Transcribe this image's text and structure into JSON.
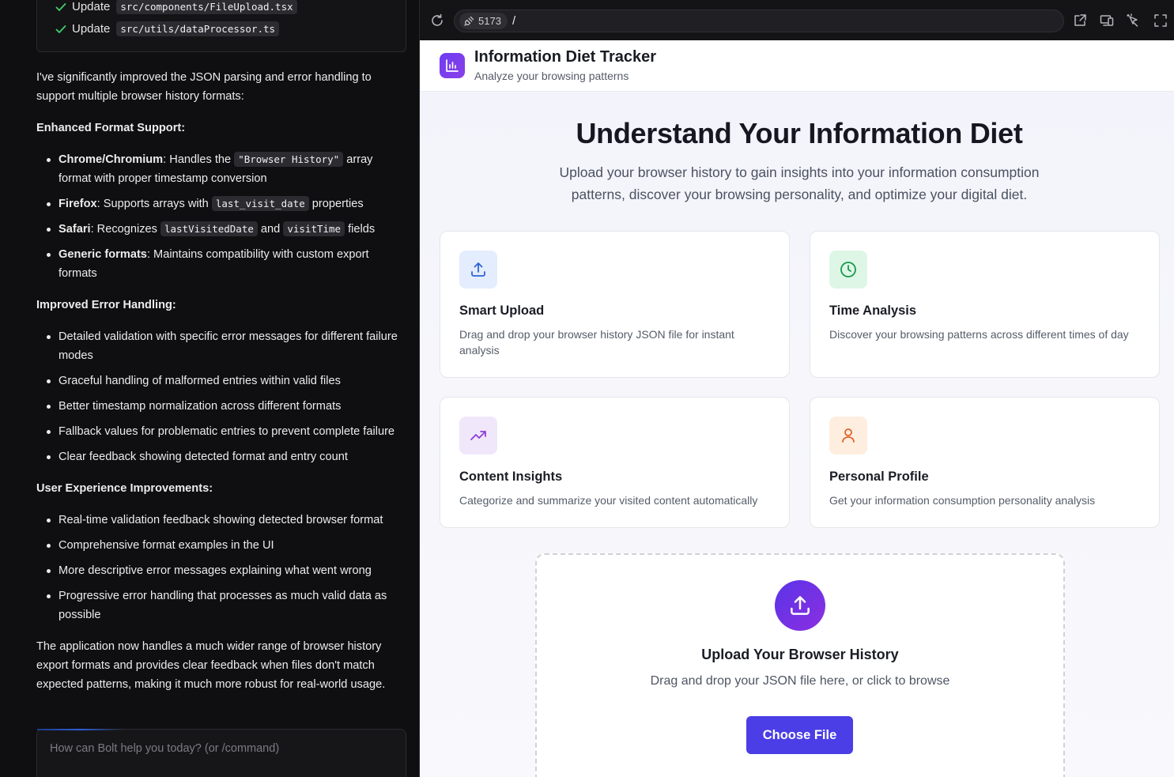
{
  "chat": {
    "files": [
      {
        "action": "Update",
        "path": "src/components/FileUpload.tsx"
      },
      {
        "action": "Update",
        "path": "src/utils/dataProcessor.ts"
      }
    ],
    "intro": "I've significantly improved the JSON parsing and error handling to support multiple browser history formats:",
    "section1_title": "Enhanced Format Support:",
    "s1": {
      "chrome_label": "Chrome/Chromium",
      "chrome_pre": ": Handles the ",
      "chrome_code": "\"Browser History\"",
      "chrome_post": " array format with proper timestamp conversion",
      "firefox_label": "Firefox",
      "firefox_pre": ": Supports arrays with ",
      "firefox_code": "last_visit_date",
      "firefox_post": " properties",
      "safari_label": "Safari",
      "safari_pre": ": Recognizes ",
      "safari_code1": "lastVisitedDate",
      "safari_mid": " and ",
      "safari_code2": "visitTime",
      "safari_post": " fields",
      "generic_label": "Generic formats",
      "generic_text": ": Maintains compatibility with custom export formats"
    },
    "section2_title": "Improved Error Handling:",
    "s2_items": [
      "Detailed validation with specific error messages for different failure modes",
      "Graceful handling of malformed entries within valid files",
      "Better timestamp normalization across different formats",
      "Fallback values for problematic entries to prevent complete failure",
      "Clear feedback showing detected format and entry count"
    ],
    "section3_title": "User Experience Improvements:",
    "s3_items": [
      "Real-time validation feedback showing detected browser format",
      "Comprehensive format examples in the UI",
      "More descriptive error messages explaining what went wrong",
      "Progressive error handling that processes as much valid data as possible"
    ],
    "outro": "The application now handles a much wider range of browser history export formats and provides clear feedback when files don't match expected patterns, making it much more robust for real-world usage.",
    "prompt_placeholder": "How can Bolt help you today? (or /command)"
  },
  "browser": {
    "port": "5173",
    "path": "/"
  },
  "app": {
    "title": "Information Diet Tracker",
    "subtitle": "Analyze your browsing patterns",
    "hero_title": "Understand Your Information Diet",
    "hero_subtitle": "Upload your browser history to gain insights into your information consumption patterns, discover your browsing personality, and optimize your digital diet.",
    "features": [
      {
        "icon": "upload-icon",
        "title": "Smart Upload",
        "desc": "Drag and drop your browser history JSON file for instant analysis",
        "color": "#2f63d6",
        "bg": "#e3edfd"
      },
      {
        "icon": "clock-icon",
        "title": "Time Analysis",
        "desc": "Discover your browsing patterns across different times of day",
        "color": "#169a4a",
        "bg": "#def6e6"
      },
      {
        "icon": "trending-up-icon",
        "title": "Content Insights",
        "desc": "Categorize and summarize your visited content automatically",
        "color": "#8b3fd9",
        "bg": "#f1e7fb"
      },
      {
        "icon": "user-icon",
        "title": "Personal Profile",
        "desc": "Get your information consumption personality analysis",
        "color": "#e0632a",
        "bg": "#fdeee0"
      }
    ],
    "upload": {
      "title": "Upload Your Browser History",
      "subtitle": "Drag and drop your JSON file here, or click to browse",
      "button": "Choose File"
    }
  },
  "colors": {
    "accent": "#4b3ee6",
    "logo_gradient": [
      "#6d3df2",
      "#8a3ee8"
    ]
  }
}
